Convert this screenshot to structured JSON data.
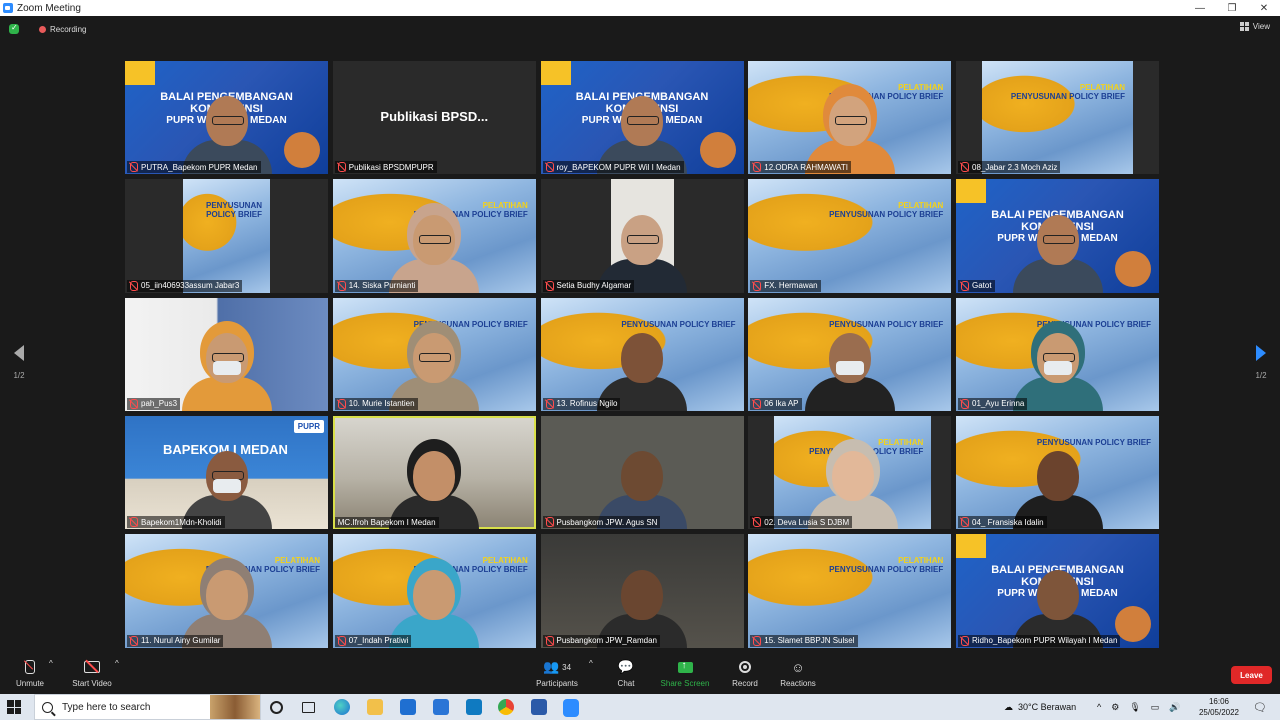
{
  "window": {
    "title": "Zoom Meeting"
  },
  "top_bar": {
    "recording_label": "Recording",
    "view_label": "View"
  },
  "pagination": {
    "left": "1/2",
    "right": "1/2"
  },
  "tiles": [
    {
      "name": "PUTRA_Bapekom PUPR Medan",
      "muted": true
    },
    {
      "name": "Publikasi BPSDMPUPR",
      "muted": true,
      "center_label": "Publikasi  BPSD..."
    },
    {
      "name": "roy_BAPEKOM PUPR Wil I Medan",
      "muted": true
    },
    {
      "name": "12.ODRA RAHMAWATI",
      "muted": true
    },
    {
      "name": "08_Jabar 2.3 Moch Aziz",
      "muted": true
    },
    {
      "name": "05_iin406933assum Jabar3",
      "muted": true
    },
    {
      "name": "14. Siska Purnianti",
      "muted": true
    },
    {
      "name": "Setia Budhy Algamar",
      "muted": true
    },
    {
      "name": "FX. Hermawan",
      "muted": true
    },
    {
      "name": "Gatot",
      "muted": true
    },
    {
      "name": "pah_Pus3",
      "muted": true
    },
    {
      "name": "10. Murie  Istantien",
      "muted": true
    },
    {
      "name": "13. Rofinus Ngilo",
      "muted": true
    },
    {
      "name": "06 Ika AP",
      "muted": true
    },
    {
      "name": "01_Ayu Erinna",
      "muted": true
    },
    {
      "name": "Bapekom1Mdn-Kholidi",
      "muted": true
    },
    {
      "name": "MC.Ifroh Bapekom I Medan",
      "muted": false
    },
    {
      "name": "Pusbangkom JPW. Agus SN",
      "muted": true
    },
    {
      "name": "02. Deva Lusia S DJBM",
      "muted": true
    },
    {
      "name": "04_ Fransiska Idalin",
      "muted": true
    },
    {
      "name": "11. Nurul Ainy Gumilar",
      "muted": true
    },
    {
      "name": "07_Indah Pratiwi",
      "muted": true
    },
    {
      "name": "Pusbangkom JPW_Ramdan",
      "muted": true
    },
    {
      "name": "15. Slamet BBPJN Sulsel",
      "muted": true
    },
    {
      "name": "Ridho_Bapekom PUPR Wilayah I Medan",
      "muted": true
    }
  ],
  "banners": {
    "balai_line1": "BALAI PENGEMBANGAN KOMPETENSI",
    "balai_line2": "PUPR WILAYAH I MEDAN",
    "bapekom": "BAPEKOM I MEDAN",
    "pupr": "PUPR",
    "pelatihan": "PELATIHAN",
    "penyusunan": "PENYUSUNAN POLICY BRIEF"
  },
  "controls": {
    "unmute": "Unmute",
    "start_video": "Start Video",
    "participants": "Participants",
    "participants_count": "34",
    "chat": "Chat",
    "share_screen": "Share Screen",
    "record": "Record",
    "reactions": "Reactions",
    "leave": "Leave"
  },
  "taskbar": {
    "search_placeholder": "Type here to search",
    "weather": "30°C  Berawan",
    "time": "16:06",
    "date": "25/05/2022"
  },
  "colors": {
    "accent": "#2d8cff",
    "leave": "#e02828",
    "share": "#2fb34a",
    "muted": "#ff4d4d",
    "speaker_outline": "#d9e04a"
  }
}
